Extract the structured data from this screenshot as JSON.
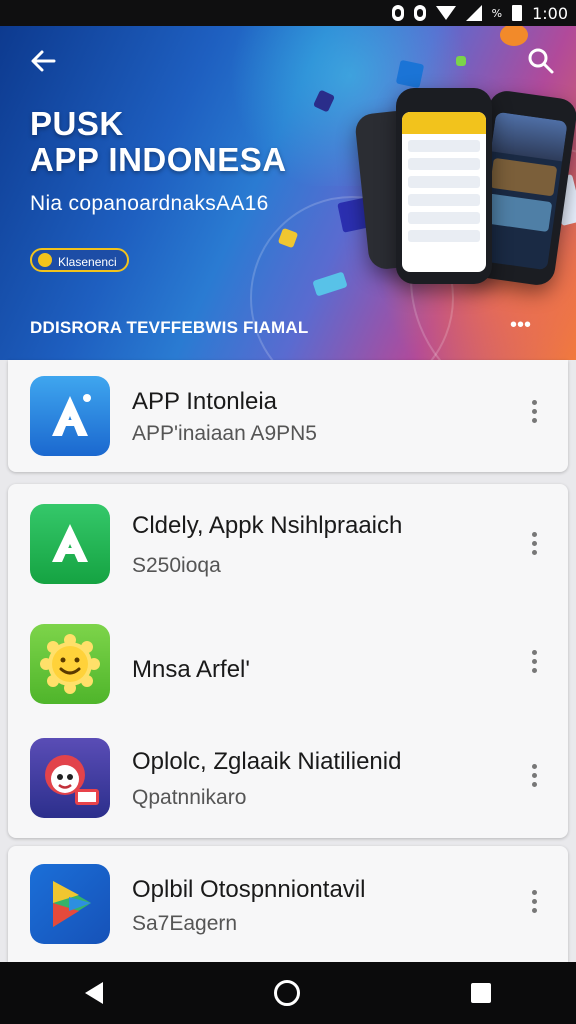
{
  "status_bar": {
    "time": "1:00",
    "battery_pct": "%"
  },
  "banner": {
    "title_line1": "PUSK",
    "title_line2": "APP INDONESA",
    "subtitle": "Nia copanoardnaksAA16",
    "chip_label": "Klasenenci",
    "footer": "DDISRORA TEVFFEBWIS FIAMAL",
    "more": "•••"
  },
  "icons": {
    "back": "arrow-left-icon",
    "search": "search-icon",
    "more": "more-vert-icon"
  },
  "featured": {
    "name": "APP Intonleia",
    "subtitle": "APP'inaiaan A9PN5"
  },
  "list": [
    {
      "name": "Cldely, Appk Nsihlpraaich",
      "subtitle": "S250ioqa",
      "icon": "green-letter-a-icon"
    },
    {
      "name": "Mnsa Arfel'",
      "subtitle": "",
      "icon": "smiley-sun-icon"
    },
    {
      "name": "Oplolc, Zglaaik Niatilienid",
      "subtitle": "Qpatnnikaro",
      "icon": "character-mascot-icon"
    },
    {
      "name": "Oplbil Otospnniontavil",
      "subtitle": "Sa7Eagern",
      "icon": "colorful-play-icon"
    }
  ],
  "colors": {
    "accent_blue": "#1e5fc0",
    "accent_green": "#1fb14a",
    "banner_orange": "#f07a3d"
  }
}
